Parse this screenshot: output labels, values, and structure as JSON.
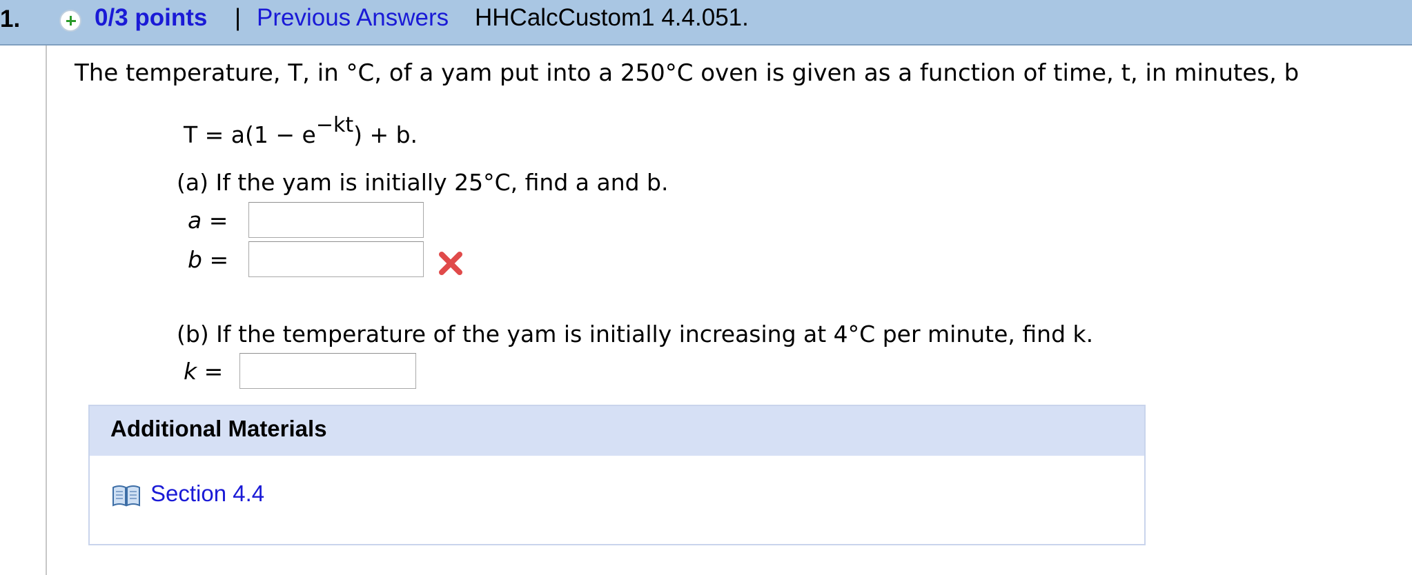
{
  "header": {
    "question_number": "1.",
    "points": "0/3 points",
    "separator": "|",
    "previous_answers": "Previous Answers",
    "question_id": "HHCalcCustom1 4.4.051."
  },
  "problem": {
    "intro": "The temperature, T, in °C, of a yam put into a 250°C oven is given as a function of time, t, in minutes, b",
    "formula_lhs": "T = a(1 − e",
    "formula_exp": "−kt",
    "formula_rhs": ") + b.",
    "part_a": "(a) If the yam is initially 25°C, find a and b.",
    "label_a": "a",
    "label_b": "b",
    "equals": "=",
    "part_b": "(b) If the temperature of the yam is initially increasing at 4°C per minute, find k.",
    "label_k": "k"
  },
  "answers": {
    "a": "",
    "b": "",
    "k": ""
  },
  "status": {
    "b_incorrect_icon": "x-icon",
    "color": "#e04a4a"
  },
  "materials": {
    "title": "Additional Materials",
    "link_icon": "book-icon",
    "link_label": "Section 4.4"
  }
}
